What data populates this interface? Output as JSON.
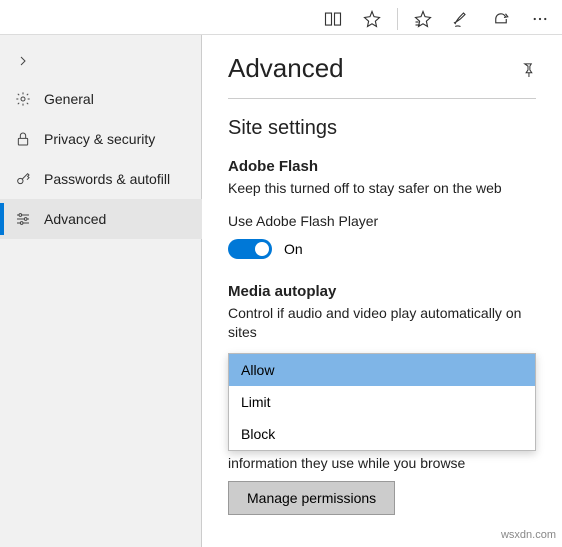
{
  "topbar": {
    "icons": [
      "reading-view",
      "favorite-star",
      "favorites-list",
      "notes",
      "share",
      "more"
    ]
  },
  "sidebar": {
    "items": [
      {
        "icon": "settings-gear",
        "label": "General"
      },
      {
        "icon": "lock",
        "label": "Privacy & security"
      },
      {
        "icon": "key",
        "label": "Passwords & autofill"
      },
      {
        "icon": "sliders",
        "label": "Advanced"
      }
    ],
    "activeIndex": 3
  },
  "content": {
    "title": "Advanced",
    "section": "Site settings",
    "flash": {
      "heading": "Adobe Flash",
      "description": "Keep this turned off to stay safer on the web",
      "toggleLabel": "Use Adobe Flash Player",
      "toggleState": "On"
    },
    "media": {
      "heading": "Media autoplay",
      "description": "Control if audio and video play automatically on sites",
      "options": [
        "Allow",
        "Limit",
        "Block"
      ],
      "selected": "Allow"
    },
    "truncated": "information they use while you browse",
    "button": "Manage permissions"
  },
  "watermark": "wsxdn.com"
}
